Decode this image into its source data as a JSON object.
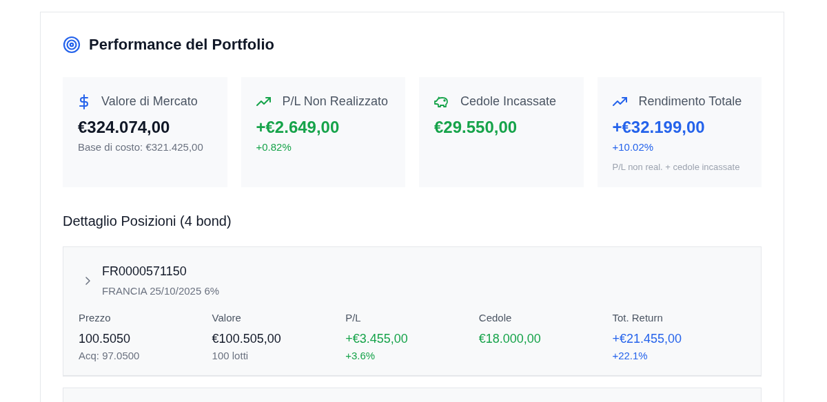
{
  "title": "Performance del Portfolio",
  "stats": [
    {
      "kind": "dollar",
      "label": "Valore di Mercato",
      "value": "€324.074,00",
      "color": "#111827",
      "sub": "Base di costo: €321.425,00"
    },
    {
      "kind": "trend",
      "label": "P/L Non Realizzato",
      "value": "+€2.649,00",
      "color": "#16a34a",
      "sub": "+0.82%"
    },
    {
      "kind": "piggy",
      "label": "Cedole Incassate",
      "value": "€29.550,00",
      "color": "#16a34a"
    },
    {
      "kind": "trend",
      "label": "Rendimento Totale",
      "value": "+€32.199,00",
      "color": "#2563eb",
      "sub": "+10.02%",
      "note": "P/L non real. + cedole incassate"
    }
  ],
  "section_title": "Dettaglio Posizioni (4 bond)",
  "positions": [
    {
      "isin": "FR0000571150",
      "name": "FRANCIA 25/10/2025 6%",
      "expanded": false,
      "metrics": [
        {
          "label": "Prezzo",
          "value": "100.5050",
          "color": "#111827",
          "sub": "Acq: 97.0500"
        },
        {
          "label": "Valore",
          "value": "€100.505,00",
          "color": "#111827",
          "sub": "100 lotti"
        },
        {
          "label": "P/L",
          "value": "+€3.455,00",
          "color": "#16a34a",
          "sub": "+3.6%"
        },
        {
          "label": "Cedole",
          "value": "€18.000,00",
          "color": "#16a34a"
        },
        {
          "label": "Tot. Return",
          "value": "+€21.455,00",
          "color": "#2563eb",
          "sub": "+22.1%"
        }
      ]
    }
  ]
}
